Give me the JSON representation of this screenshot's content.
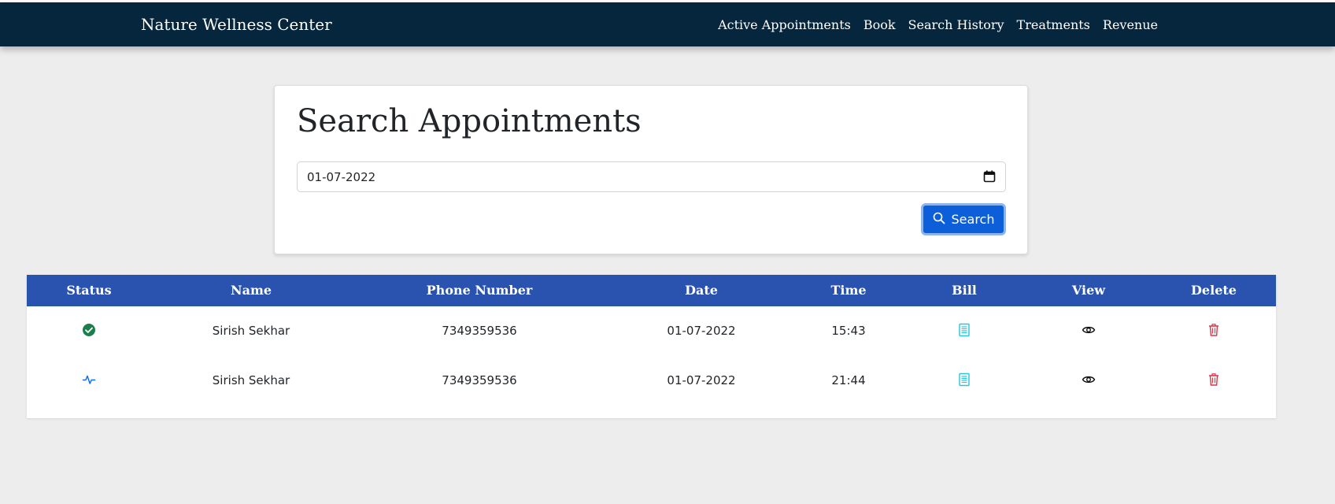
{
  "navbar": {
    "brand": "Nature Wellness Center",
    "links": [
      "Active Appointments",
      "Book",
      "Search History",
      "Treatments",
      "Revenue"
    ]
  },
  "search_card": {
    "title": "Search Appointments",
    "date_value": "01-07-2022",
    "search_label": "Search"
  },
  "table": {
    "headers": [
      "Status",
      "Name",
      "Phone Number",
      "Date",
      "Time",
      "Bill",
      "View",
      "Delete"
    ],
    "rows": [
      {
        "status_icon": "check-circle-icon",
        "name": "Sirish Sekhar",
        "phone": "7349359536",
        "date": "01-07-2022",
        "time": "15:43"
      },
      {
        "status_icon": "activity-icon",
        "name": "Sirish Sekhar",
        "phone": "7349359536",
        "date": "01-07-2022",
        "time": "21:44"
      }
    ]
  },
  "colors": {
    "navbar_bg": "#06263d",
    "table_header_bg": "#2a53b0",
    "primary_button": "#0d5ed9",
    "success": "#1a7f4b",
    "bill_icon": "#28c4d8",
    "delete_icon": "#dc3545"
  }
}
